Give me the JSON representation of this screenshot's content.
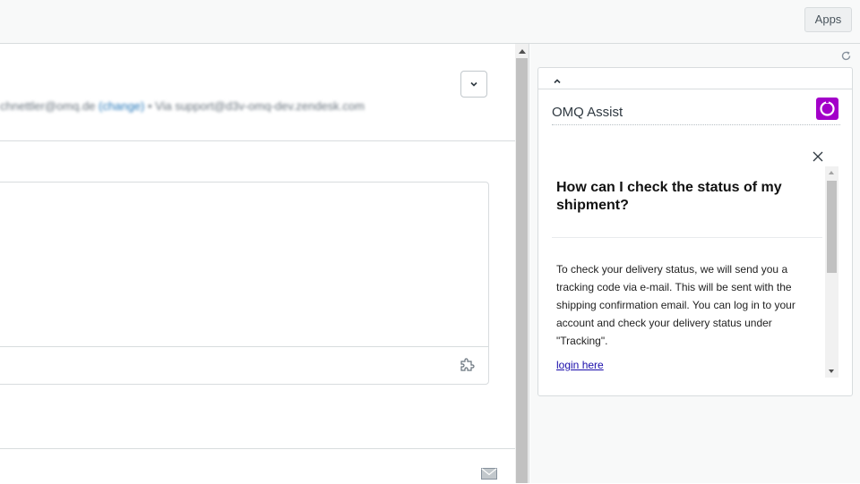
{
  "topbar": {
    "apps_label": "Apps"
  },
  "ticket": {
    "from_prefix": "chnettler@omq.de",
    "from_change": "(change)",
    "from_via": "• Via support@d3v-omq-dev.zendesk.com",
    "icons": {
      "expand": "chevron-down-icon",
      "apps": "puzzle-icon",
      "mail": "envelope-icon"
    }
  },
  "apps_panel": {
    "icons": {
      "reload": "refresh-icon",
      "collapse": "chevron-up-icon",
      "close": "close-icon"
    },
    "app": {
      "title": "OMQ Assist",
      "brand_color": "#a300c9",
      "question": "How can I check the status of my shipment?",
      "answer": "To check your delivery status, we will send you a tracking code via e-mail. This will be sent with the shipping confirmation email. You can log in to your account and check your delivery status under \"Tracking\".",
      "link_label": "login here"
    }
  }
}
